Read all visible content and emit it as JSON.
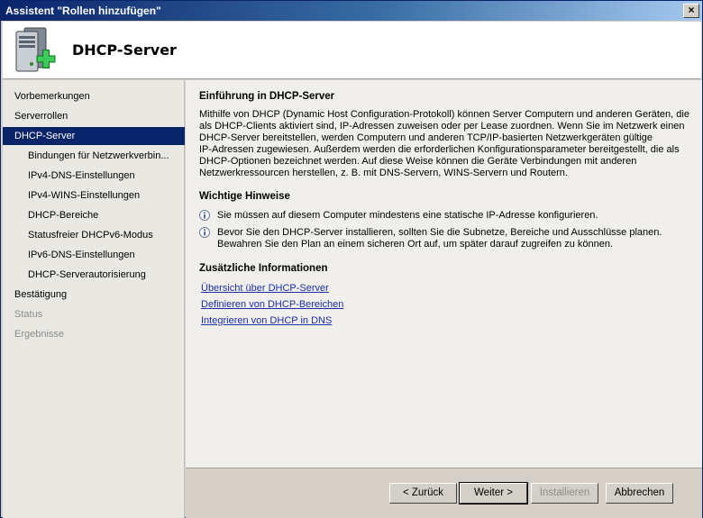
{
  "window": {
    "title": "Assistent \"Rollen hinzufügen\"",
    "close_glyph": "×"
  },
  "header": {
    "page_title": "DHCP-Server",
    "icon": "server-add-icon"
  },
  "sidebar": {
    "items": [
      {
        "label": "Vorbemerkungen",
        "state": "normal",
        "level": 0
      },
      {
        "label": "Serverrollen",
        "state": "normal",
        "level": 0
      },
      {
        "label": "DHCP-Server",
        "state": "active",
        "level": 0
      },
      {
        "label": "Bindungen für Netzwerkverbin...",
        "state": "normal",
        "level": 1
      },
      {
        "label": "IPv4-DNS-Einstellungen",
        "state": "normal",
        "level": 1
      },
      {
        "label": "IPv4-WINS-Einstellungen",
        "state": "normal",
        "level": 1
      },
      {
        "label": "DHCP-Bereiche",
        "state": "normal",
        "level": 1
      },
      {
        "label": "Statusfreier DHCPv6-Modus",
        "state": "normal",
        "level": 1
      },
      {
        "label": "IPv6-DNS-Einstellungen",
        "state": "normal",
        "level": 1
      },
      {
        "label": "DHCP-Serverautorisierung",
        "state": "normal",
        "level": 1
      },
      {
        "label": "Bestätigung",
        "state": "normal",
        "level": 0
      },
      {
        "label": "Status",
        "state": "disabled",
        "level": 0
      },
      {
        "label": "Ergebnisse",
        "state": "disabled",
        "level": 0
      }
    ]
  },
  "content": {
    "intro_heading": "Einführung in DHCP-Server",
    "intro_lines": [
      "Mithilfe von DHCP (Dynamic Host Configuration-Protokoll) können Server Computern und anderen Geräten, die",
      "als DHCP-Clients aktiviert sind, IP-Adressen zuweisen oder per Lease zuordnen. Wenn Sie im Netzwerk einen",
      "DHCP-Server bereitstellen, werden Computern und anderen TCP/IP-basierten Netzwerkgeräten gültige",
      "IP-Adressen zugewiesen. Außerdem werden die erforderlichen Konfigurationsparameter bereitgestellt, die als",
      "DHCP-Optionen bezeichnet werden. Auf diese Weise können die Geräte Verbindungen mit anderen",
      "Netzwerkressourcen herstellen, z. B. mit DNS-Servern, WINS-Servern und Routern."
    ],
    "notes_heading": "Wichtige Hinweise",
    "notes": [
      {
        "lines": [
          "Sie müssen auf diesem Computer mindestens eine statische IP-Adresse konfigurieren."
        ]
      },
      {
        "lines": [
          "Bevor Sie den DHCP-Server installieren, sollten Sie die Subnetze, Bereiche und Ausschlüsse planen.",
          "Bewahren Sie den Plan an einem sicheren Ort auf, um später darauf zugreifen zu können."
        ]
      }
    ],
    "info_heading": "Zusätzliche Informationen",
    "links": [
      "Übersicht über DHCP-Server",
      "Definieren von DHCP-Bereichen",
      "Integrieren von DHCP in DNS"
    ]
  },
  "footer": {
    "back_label": "< Zurück",
    "next_label": "Weiter >",
    "install_label": "Installieren",
    "cancel_label": "Abbrechen"
  }
}
